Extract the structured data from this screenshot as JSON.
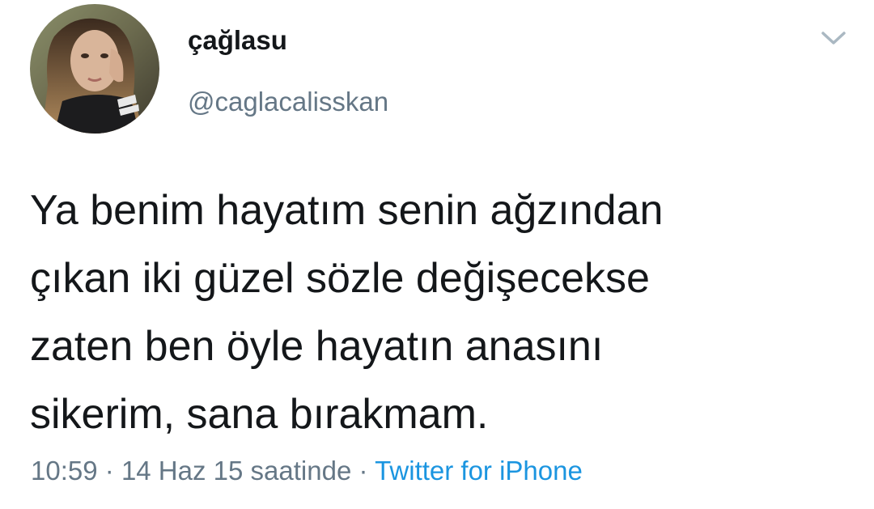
{
  "user": {
    "display_name": "çağlasu",
    "handle": "@caglacalisskan",
    "avatar_icon": "profile-photo"
  },
  "tweet": {
    "lines": [
      "Ya benim hayatım senin ağzından",
      "çıkan iki güzel sözle değişecekse",
      "zaten ben öyle hayatın anasını",
      "sikerim, sana bırakmam."
    ]
  },
  "meta": {
    "time": "10:59",
    "separator": "·",
    "date": "14 Haz 15 saatinde",
    "source": "Twitter for iPhone"
  },
  "menu": {
    "icon": "chevron-down-icon"
  },
  "colors": {
    "text": "#14171a",
    "secondary": "#657786",
    "link": "#1b95e0",
    "chevron": "#aab8c2"
  }
}
